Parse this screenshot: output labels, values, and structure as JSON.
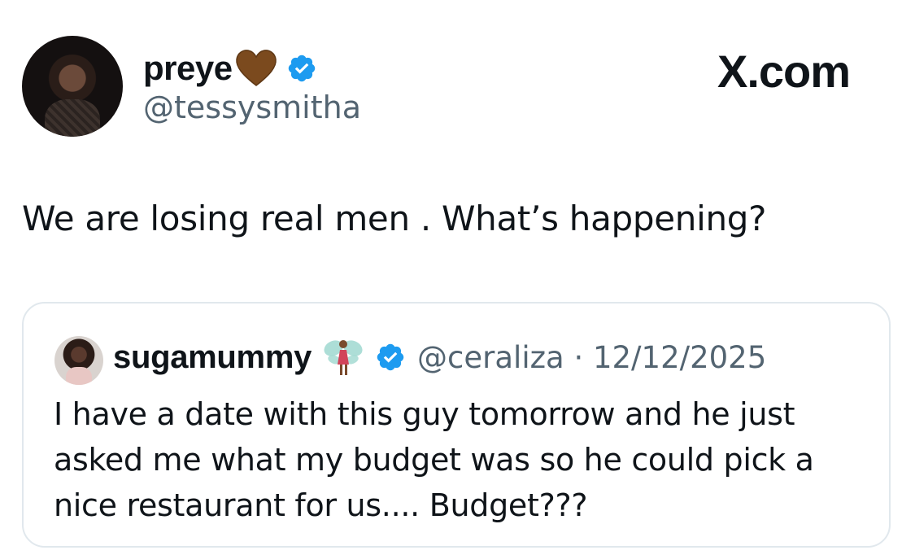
{
  "author": {
    "name": "preye",
    "handle": "@tessysmitha"
  },
  "brand": "X.com",
  "tweet": {
    "text": "We are losing real men . What’s happening?"
  },
  "quote": {
    "name": "sugamummy",
    "handle": "@ceraliza",
    "date": "12/12/2025",
    "meta": "@ceraliza · 12/12/2025",
    "text": "I have a date with this guy tomorrow and he just asked me what my budget was so he could pick a nice restaurant for us.... Budget???"
  },
  "colors": {
    "verified": "#1d9bf0",
    "heart": "#7b4a1e",
    "secondary_text": "#536471",
    "border": "#e1e8ed"
  },
  "icons": {
    "author_badge": "brown-heart-icon",
    "verified": "verified-badge-icon",
    "quote_badge": "fairy-icon"
  }
}
